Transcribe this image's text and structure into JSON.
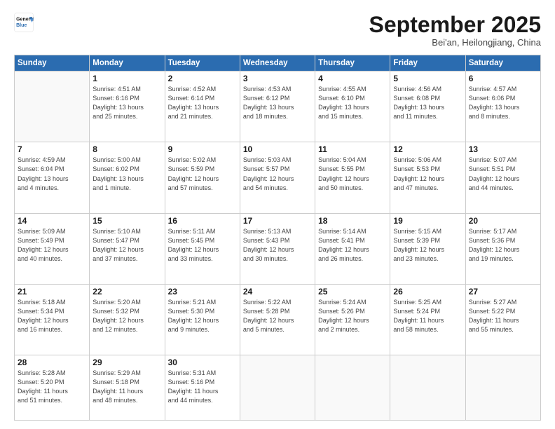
{
  "logo": {
    "line1": "General",
    "line2": "Blue"
  },
  "header": {
    "month": "September 2025",
    "location": "Bei'an, Heilongjiang, China"
  },
  "weekdays": [
    "Sunday",
    "Monday",
    "Tuesday",
    "Wednesday",
    "Thursday",
    "Friday",
    "Saturday"
  ],
  "weeks": [
    [
      {
        "day": "",
        "info": ""
      },
      {
        "day": "1",
        "info": "Sunrise: 4:51 AM\nSunset: 6:16 PM\nDaylight: 13 hours\nand 25 minutes."
      },
      {
        "day": "2",
        "info": "Sunrise: 4:52 AM\nSunset: 6:14 PM\nDaylight: 13 hours\nand 21 minutes."
      },
      {
        "day": "3",
        "info": "Sunrise: 4:53 AM\nSunset: 6:12 PM\nDaylight: 13 hours\nand 18 minutes."
      },
      {
        "day": "4",
        "info": "Sunrise: 4:55 AM\nSunset: 6:10 PM\nDaylight: 13 hours\nand 15 minutes."
      },
      {
        "day": "5",
        "info": "Sunrise: 4:56 AM\nSunset: 6:08 PM\nDaylight: 13 hours\nand 11 minutes."
      },
      {
        "day": "6",
        "info": "Sunrise: 4:57 AM\nSunset: 6:06 PM\nDaylight: 13 hours\nand 8 minutes."
      }
    ],
    [
      {
        "day": "7",
        "info": "Sunrise: 4:59 AM\nSunset: 6:04 PM\nDaylight: 13 hours\nand 4 minutes."
      },
      {
        "day": "8",
        "info": "Sunrise: 5:00 AM\nSunset: 6:02 PM\nDaylight: 13 hours\nand 1 minute."
      },
      {
        "day": "9",
        "info": "Sunrise: 5:02 AM\nSunset: 5:59 PM\nDaylight: 12 hours\nand 57 minutes."
      },
      {
        "day": "10",
        "info": "Sunrise: 5:03 AM\nSunset: 5:57 PM\nDaylight: 12 hours\nand 54 minutes."
      },
      {
        "day": "11",
        "info": "Sunrise: 5:04 AM\nSunset: 5:55 PM\nDaylight: 12 hours\nand 50 minutes."
      },
      {
        "day": "12",
        "info": "Sunrise: 5:06 AM\nSunset: 5:53 PM\nDaylight: 12 hours\nand 47 minutes."
      },
      {
        "day": "13",
        "info": "Sunrise: 5:07 AM\nSunset: 5:51 PM\nDaylight: 12 hours\nand 44 minutes."
      }
    ],
    [
      {
        "day": "14",
        "info": "Sunrise: 5:09 AM\nSunset: 5:49 PM\nDaylight: 12 hours\nand 40 minutes."
      },
      {
        "day": "15",
        "info": "Sunrise: 5:10 AM\nSunset: 5:47 PM\nDaylight: 12 hours\nand 37 minutes."
      },
      {
        "day": "16",
        "info": "Sunrise: 5:11 AM\nSunset: 5:45 PM\nDaylight: 12 hours\nand 33 minutes."
      },
      {
        "day": "17",
        "info": "Sunrise: 5:13 AM\nSunset: 5:43 PM\nDaylight: 12 hours\nand 30 minutes."
      },
      {
        "day": "18",
        "info": "Sunrise: 5:14 AM\nSunset: 5:41 PM\nDaylight: 12 hours\nand 26 minutes."
      },
      {
        "day": "19",
        "info": "Sunrise: 5:15 AM\nSunset: 5:39 PM\nDaylight: 12 hours\nand 23 minutes."
      },
      {
        "day": "20",
        "info": "Sunrise: 5:17 AM\nSunset: 5:36 PM\nDaylight: 12 hours\nand 19 minutes."
      }
    ],
    [
      {
        "day": "21",
        "info": "Sunrise: 5:18 AM\nSunset: 5:34 PM\nDaylight: 12 hours\nand 16 minutes."
      },
      {
        "day": "22",
        "info": "Sunrise: 5:20 AM\nSunset: 5:32 PM\nDaylight: 12 hours\nand 12 minutes."
      },
      {
        "day": "23",
        "info": "Sunrise: 5:21 AM\nSunset: 5:30 PM\nDaylight: 12 hours\nand 9 minutes."
      },
      {
        "day": "24",
        "info": "Sunrise: 5:22 AM\nSunset: 5:28 PM\nDaylight: 12 hours\nand 5 minutes."
      },
      {
        "day": "25",
        "info": "Sunrise: 5:24 AM\nSunset: 5:26 PM\nDaylight: 12 hours\nand 2 minutes."
      },
      {
        "day": "26",
        "info": "Sunrise: 5:25 AM\nSunset: 5:24 PM\nDaylight: 11 hours\nand 58 minutes."
      },
      {
        "day": "27",
        "info": "Sunrise: 5:27 AM\nSunset: 5:22 PM\nDaylight: 11 hours\nand 55 minutes."
      }
    ],
    [
      {
        "day": "28",
        "info": "Sunrise: 5:28 AM\nSunset: 5:20 PM\nDaylight: 11 hours\nand 51 minutes."
      },
      {
        "day": "29",
        "info": "Sunrise: 5:29 AM\nSunset: 5:18 PM\nDaylight: 11 hours\nand 48 minutes."
      },
      {
        "day": "30",
        "info": "Sunrise: 5:31 AM\nSunset: 5:16 PM\nDaylight: 11 hours\nand 44 minutes."
      },
      {
        "day": "",
        "info": ""
      },
      {
        "day": "",
        "info": ""
      },
      {
        "day": "",
        "info": ""
      },
      {
        "day": "",
        "info": ""
      }
    ]
  ]
}
